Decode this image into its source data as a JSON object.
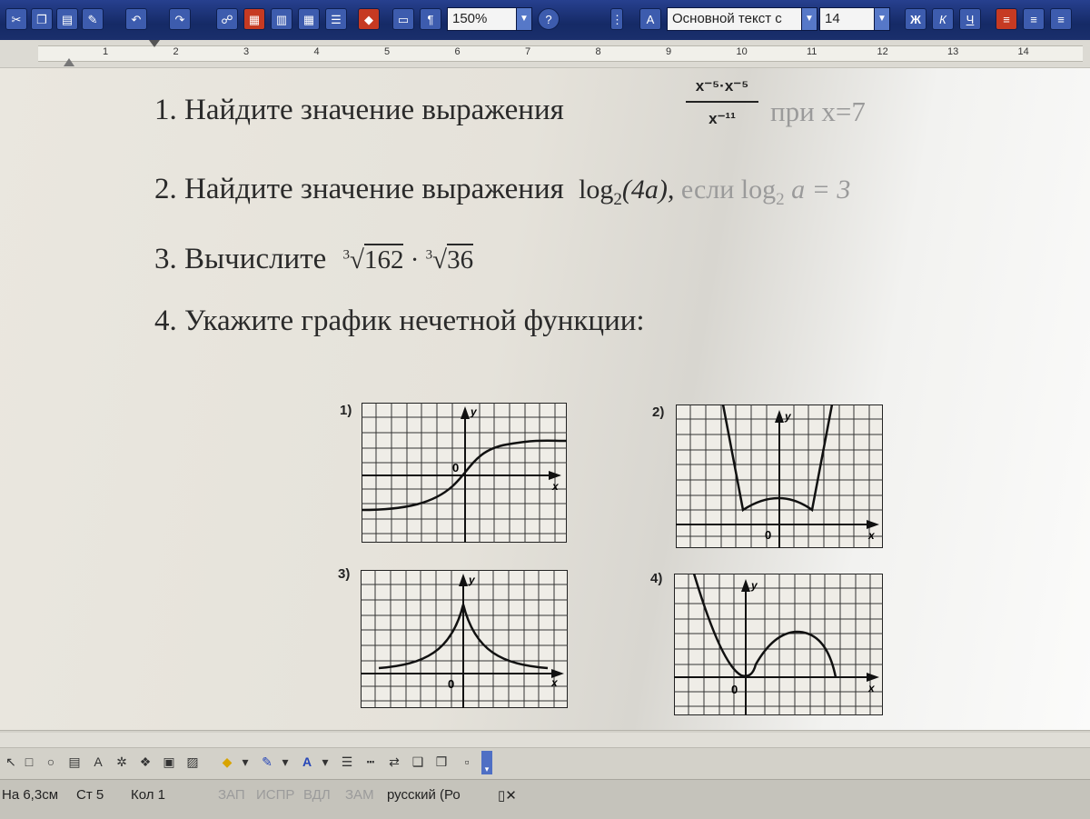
{
  "toolbar": {
    "zoom": "150%",
    "style": "Основной текст с",
    "font_size": "14",
    "bold_icon": "Ж",
    "italic_icon": "К",
    "underline_icon": "Ч",
    "paragraph_mark": "¶"
  },
  "ruler": {
    "numbers": [
      "1",
      "2",
      "3",
      "4",
      "5",
      "6",
      "7",
      "8",
      "9",
      "10",
      "11",
      "12",
      "13",
      "14"
    ]
  },
  "document": {
    "task1": {
      "text": "1. Найдите значение выражения",
      "numerator": "x⁻⁵·x⁻⁵",
      "denominator": "x⁻¹¹",
      "tail": "при x=7"
    },
    "task2": {
      "text": "2. Найдите значение выражения",
      "expr_lead": "log",
      "base": "2",
      "arg": "(4a), ",
      "cond_word": "если ",
      "cond_log": "log",
      "cond_base": "2",
      "cond_rest": " a = 3"
    },
    "task3": {
      "text": "3. Вычислите",
      "root_index": "3",
      "radicand1": "162",
      "dot": " · ",
      "radicand2": "36"
    },
    "task4": {
      "text": "4. Укажите график нечетной функции:"
    },
    "graphs": [
      {
        "label": "1)",
        "axis_y": "y",
        "axis_x": "x",
        "origin": "0"
      },
      {
        "label": "2)",
        "axis_y": "y",
        "axis_x": "x",
        "origin": "0"
      },
      {
        "label": "3)",
        "axis_y": "y",
        "axis_x": "x",
        "origin": "0"
      },
      {
        "label": "4)",
        "axis_y": "y",
        "axis_x": "x",
        "origin": "0"
      }
    ]
  },
  "statusbar": {
    "position": "На 6,3см",
    "page": "Ст 5",
    "column": "Кол 1",
    "rec": "ЗАП",
    "trk": "ИСПР",
    "ext": "ВДЛ",
    "ovr": "ЗАМ",
    "language": "русский (Ро"
  }
}
